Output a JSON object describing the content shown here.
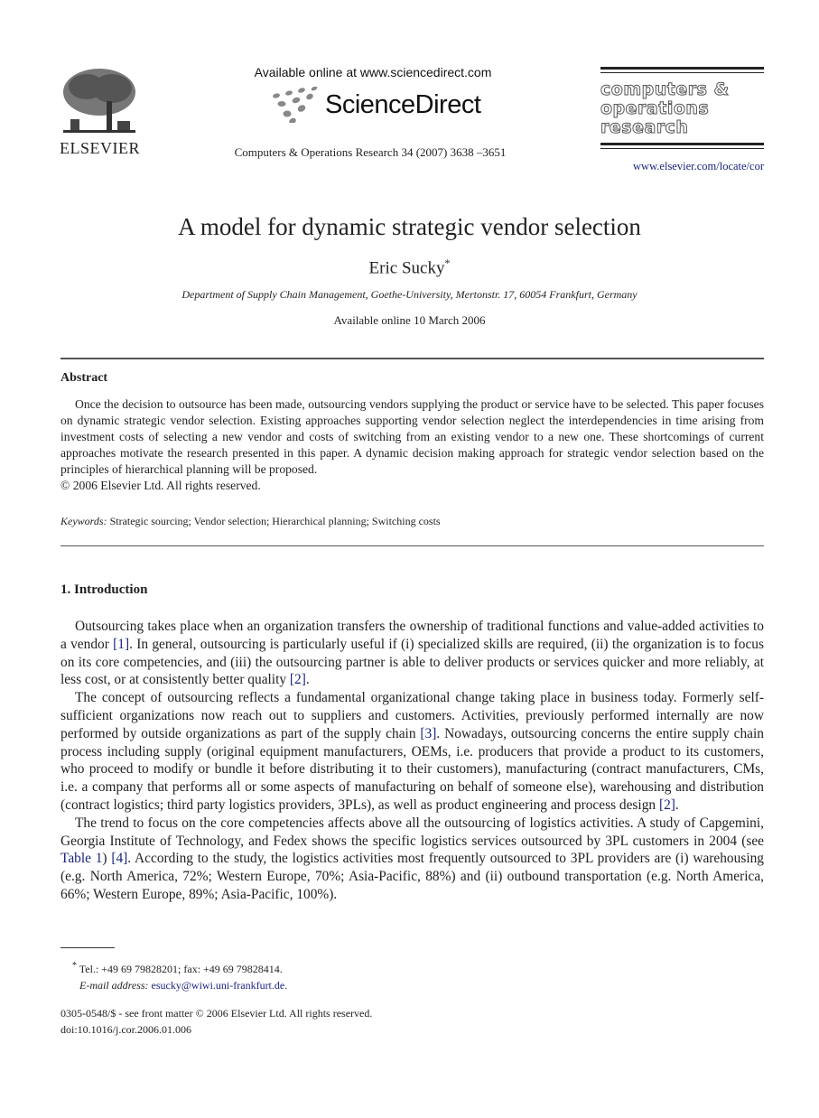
{
  "header": {
    "publisher_logo_text": "ELSEVIER",
    "sd_available": "Available online at www.sciencedirect.com",
    "sd_brand": "ScienceDirect",
    "journal_ref": "Computers & Operations Research 34 (2007) 3638 –3651",
    "journal_name_lines": [
      "computers &",
      "operations",
      "research"
    ],
    "journal_url": "www.elsevier.com/locate/cor"
  },
  "article": {
    "title": "A model for dynamic strategic vendor selection",
    "author": "Eric Sucky",
    "author_mark": "*",
    "affiliation": "Department of Supply Chain Management, Goethe-University, Mertonstr. 17, 60054 Frankfurt, Germany",
    "available_online": "Available online 10 March 2006"
  },
  "abstract": {
    "heading": "Abstract",
    "text": "Once the decision to outsource has been made, outsourcing vendors supplying the product or service have to be selected. This paper focuses on dynamic strategic vendor selection. Existing approaches supporting vendor selection neglect the interdependencies in time arising from investment costs of selecting a new vendor and costs of switching from an existing vendor to a new one. These shortcomings of current approaches motivate the research presented in this paper. A dynamic decision making approach for strategic vendor selection based on the principles of hierarchical planning will be proposed.",
    "copyright": "© 2006 Elsevier Ltd. All rights reserved."
  },
  "keywords": {
    "label": "Keywords:",
    "text": " Strategic sourcing; Vendor selection; Hierarchical planning; Switching costs"
  },
  "section1": {
    "heading": "1.  Introduction",
    "p1": {
      "a": "Outsourcing takes place when an organization transfers the ownership of traditional functions and value-added activities to a vendor ",
      "ref1": "[1]",
      "b": ". In general, outsourcing is particularly useful if (i) specialized skills are required, (ii) the organization is to focus on its core competencies, and (iii) the outsourcing partner is able to deliver products or services quicker and more reliably, at less cost, or at consistently better quality ",
      "ref2": "[2]",
      "c": "."
    },
    "p2": {
      "a": "The concept of outsourcing reflects a fundamental organizational change taking place in business today. Formerly self-sufficient organizations now reach out to suppliers and customers. Activities, previously performed internally are now performed by outside organizations as part of the supply chain ",
      "ref1": "[3]",
      "b": ". Nowadays, outsourcing concerns the entire supply chain process including supply (original equipment manufacturers, OEMs, i.e. producers that provide a product to its customers, who proceed to modify or bundle it before distributing it to their customers), manufacturing (contract manufacturers, CMs, i.e. a company that performs all or some aspects of manufacturing on behalf of someone else), warehousing and distribution (contract logistics; third party logistics providers, 3PLs), as well as product engineering and process design ",
      "ref2": "[2]",
      "c": "."
    },
    "p3": {
      "a": "The trend to focus on the core competencies affects above all the outsourcing of logistics activities. A study of Capgemini, Georgia Institute of Technology, and Fedex shows the specific logistics services outsourced by 3PL customers in 2004 (see ",
      "ref1": "Table 1",
      "b": ") ",
      "ref2": "[4]",
      "c": ". According to the study, the logistics activities most frequently outsourced to 3PL providers are (i) warehousing (e.g. North America, 72%; Western Europe, 70%; Asia-Pacific, 88%) and (ii) outbound transportation (e.g. North America, 66%; Western Europe, 89%; Asia-Pacific, 100%)."
    }
  },
  "footnotes": {
    "contact": "Tel.: +49 69 79828201; fax: +49 69 79828414.",
    "email_label": "E-mail address:",
    "email": "esucky@wiwi.uni-frankfurt.de",
    "front_matter": "0305-0548/$ - see front matter © 2006 Elsevier Ltd. All rights reserved.",
    "doi": "doi:10.1016/j.cor.2006.01.006"
  }
}
